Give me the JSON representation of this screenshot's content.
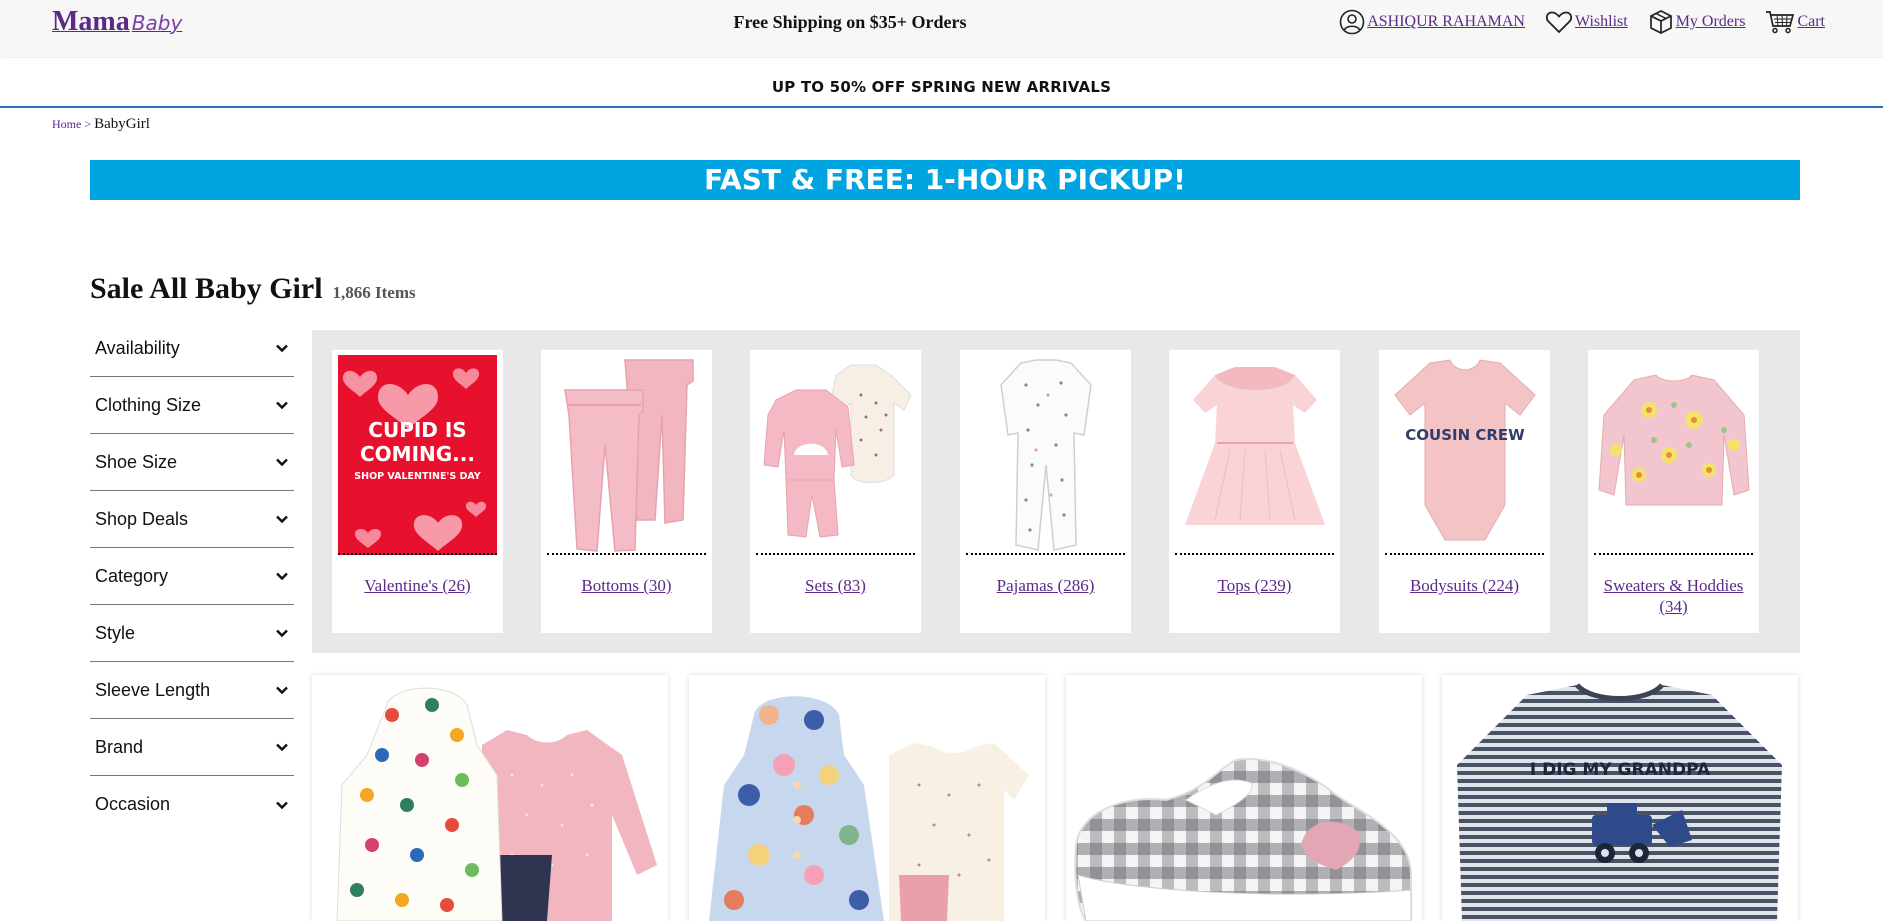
{
  "header": {
    "logo_main": "Mama",
    "logo_sub": "Baby",
    "shipping_promo": "Free Shipping on $35+ Orders",
    "nav": [
      {
        "label": "ASHIQUR RAHAMAN",
        "icon": "user-icon"
      },
      {
        "label": "Wishlist",
        "icon": "heart-icon"
      },
      {
        "label": "My Orders",
        "icon": "box-icon"
      },
      {
        "label": "Cart",
        "icon": "cart-icon"
      }
    ]
  },
  "sub_promo": "UP TO 50% OFF SPRING NEW ARRIVALS",
  "breadcrumb": {
    "home": "Home > ",
    "current": "BabyGirl"
  },
  "pickup_banner": "FAST & FREE: 1-HOUR PICKUP!",
  "page": {
    "title": "Sale All Baby Girl",
    "count": "1,866 Items"
  },
  "filters": [
    {
      "label": "Availability",
      "icon": "chevron-down-icon"
    },
    {
      "label": "Clothing Size",
      "icon": "chevron-down-icon"
    },
    {
      "label": "Shoe Size",
      "icon": "chevron-down-icon"
    },
    {
      "label": "Shop Deals",
      "icon": "chevron-down-icon"
    },
    {
      "label": "Category",
      "icon": "chevron-down-icon"
    },
    {
      "label": "Style",
      "icon": "chevron-down-icon"
    },
    {
      "label": "Sleeve Length",
      "icon": "chevron-down-icon"
    },
    {
      "label": "Brand",
      "icon": "chevron-down-icon"
    },
    {
      "label": "Occasion",
      "icon": "chevron-down-icon"
    }
  ],
  "categories": [
    {
      "label": "Valentine's (26)",
      "image": "valentines-promo-image",
      "promo": {
        "line1": "CUPID IS",
        "line2": "COMING...",
        "line3": "SHOP VALENTINE'S DAY"
      }
    },
    {
      "label": "Bottoms (30)",
      "image": "pink-leggings-image"
    },
    {
      "label": "Sets (83)",
      "image": "pink-set-image"
    },
    {
      "label": "Pajamas (286)",
      "image": "white-pajamas-image"
    },
    {
      "label": "Tops (239)",
      "image": "pink-dress-image"
    },
    {
      "label": "Bodysuits (224)",
      "image": "cousin-crew-bodysuit-image",
      "print_text": "COUSIN CREW"
    },
    {
      "label": "Sweaters & Hoddies (34)",
      "image": "floral-sweater-image"
    }
  ],
  "products": [
    {
      "image": "leaf-hoodie-set-image"
    },
    {
      "image": "floral-jacket-set-image"
    },
    {
      "image": "plaid-sneaker-image"
    },
    {
      "image": "striped-tee-image",
      "print_text": "I DIG MY GRANDPA"
    }
  ],
  "colors": {
    "accent": "#5b2a86",
    "banner": "#00a4e0",
    "strip_bg": "#e8e8e8",
    "divider": "#2b6cc4"
  }
}
